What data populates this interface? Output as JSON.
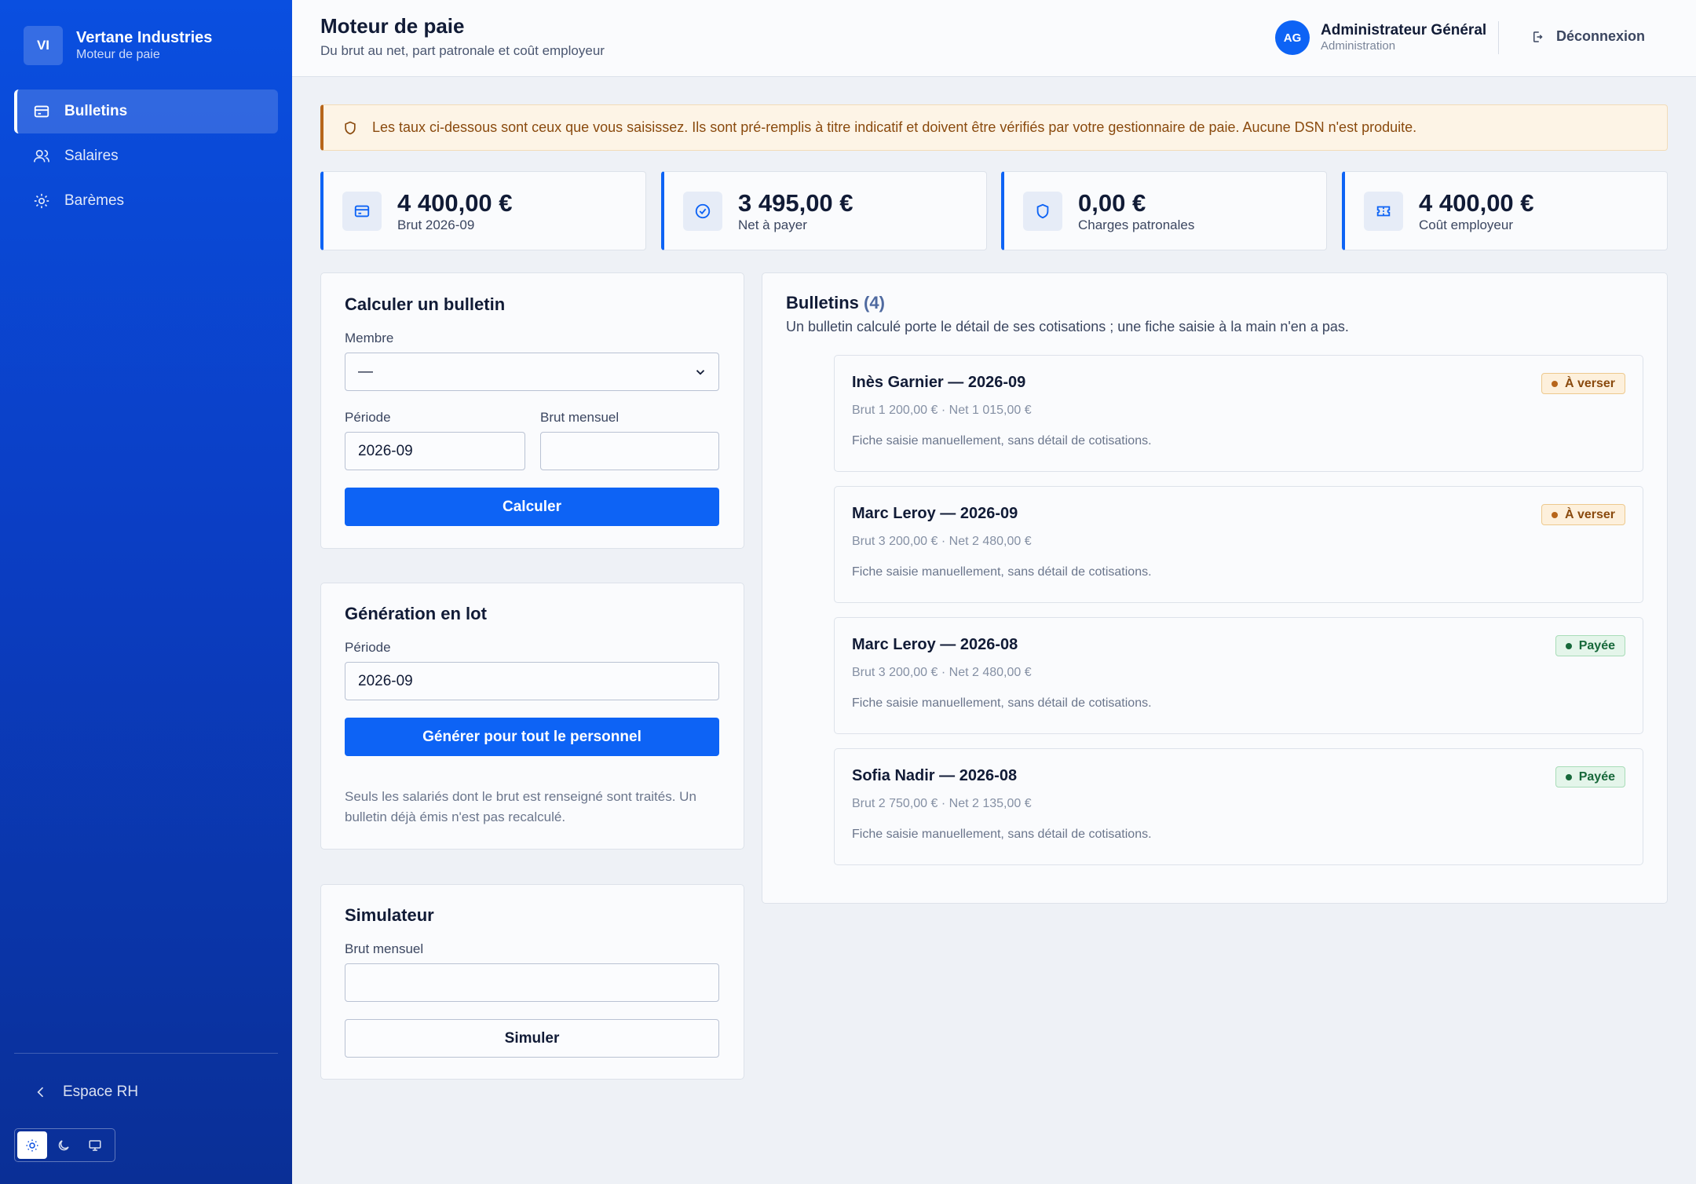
{
  "brand": {
    "initials": "VI",
    "name": "Vertane Industries",
    "subtitle": "Moteur de paie"
  },
  "sidebar": {
    "items": [
      {
        "label": "Bulletins",
        "icon": "payslip-card-icon",
        "active": true
      },
      {
        "label": "Salaires",
        "icon": "users-icon",
        "active": false
      },
      {
        "label": "Barèmes",
        "icon": "gear-icon",
        "active": false
      }
    ],
    "back_label": "Espace RH",
    "theme_modes": [
      "light",
      "dark",
      "system"
    ]
  },
  "header": {
    "title": "Moteur de paie",
    "subtitle": "Du brut au net, part patronale et coût employeur",
    "user": {
      "initials": "AG",
      "name": "Administrateur Général",
      "role": "Administration"
    },
    "logout_label": "Déconnexion"
  },
  "alert": {
    "text": "Les taux ci-dessous sont ceux que vous saisissez. Ils sont pré-remplis à titre indicatif et doivent être vérifiés par votre gestionnaire de paie. Aucune DSN n'est produite."
  },
  "kpis": [
    {
      "value": "4 400,00 €",
      "label": "Brut 2026-09",
      "icon": "card-icon"
    },
    {
      "value": "3 495,00 €",
      "label": "Net à payer",
      "icon": "check-circle-icon"
    },
    {
      "value": "0,00 €",
      "label": "Charges patronales",
      "icon": "shield-icon"
    },
    {
      "value": "4 400,00 €",
      "label": "Coût employeur",
      "icon": "ticket-icon"
    }
  ],
  "calc": {
    "title": "Calculer un bulletin",
    "member_label": "Membre",
    "member_value": "—",
    "period_label": "Période",
    "period_value": "2026-09",
    "gross_label": "Brut mensuel",
    "gross_value": "",
    "button": "Calculer"
  },
  "batch": {
    "title": "Génération en lot",
    "period_label": "Période",
    "period_value": "2026-09",
    "button": "Générer pour tout le personnel",
    "note": "Seuls les salariés dont le brut est renseigné sont traités. Un bulletin déjà émis n'est pas recalculé."
  },
  "sim": {
    "title": "Simulateur",
    "gross_label": "Brut mensuel",
    "gross_value": "",
    "button": "Simuler"
  },
  "bulletins": {
    "title": "Bulletins",
    "count": "(4)",
    "description": "Un bulletin calculé porte le détail de ses cotisations ; une fiche saisie à la main n'en a pas.",
    "items": [
      {
        "name": "Inès Garnier — 2026-09",
        "amounts": "Brut 1 200,00 € · Net 1 015,00 €",
        "note": "Fiche saisie manuellement, sans détail de cotisations.",
        "status": "À verser",
        "status_kind": "warn"
      },
      {
        "name": "Marc Leroy — 2026-09",
        "amounts": "Brut 3 200,00 € · Net 2 480,00 €",
        "note": "Fiche saisie manuellement, sans détail de cotisations.",
        "status": "À verser",
        "status_kind": "warn"
      },
      {
        "name": "Marc Leroy — 2026-08",
        "amounts": "Brut 3 200,00 € · Net 2 480,00 €",
        "note": "Fiche saisie manuellement, sans détail de cotisations.",
        "status": "Payée",
        "status_kind": "ok"
      },
      {
        "name": "Sofia Nadir — 2026-08",
        "amounts": "Brut 2 750,00 € · Net 2 135,00 €",
        "note": "Fiche saisie manuellement, sans détail de cotisations.",
        "status": "Payée",
        "status_kind": "ok"
      }
    ]
  },
  "colors": {
    "primary": "#0d63f5",
    "sidebar": "#0b3ec4",
    "warn": "#b7651a",
    "success": "#17683a"
  }
}
